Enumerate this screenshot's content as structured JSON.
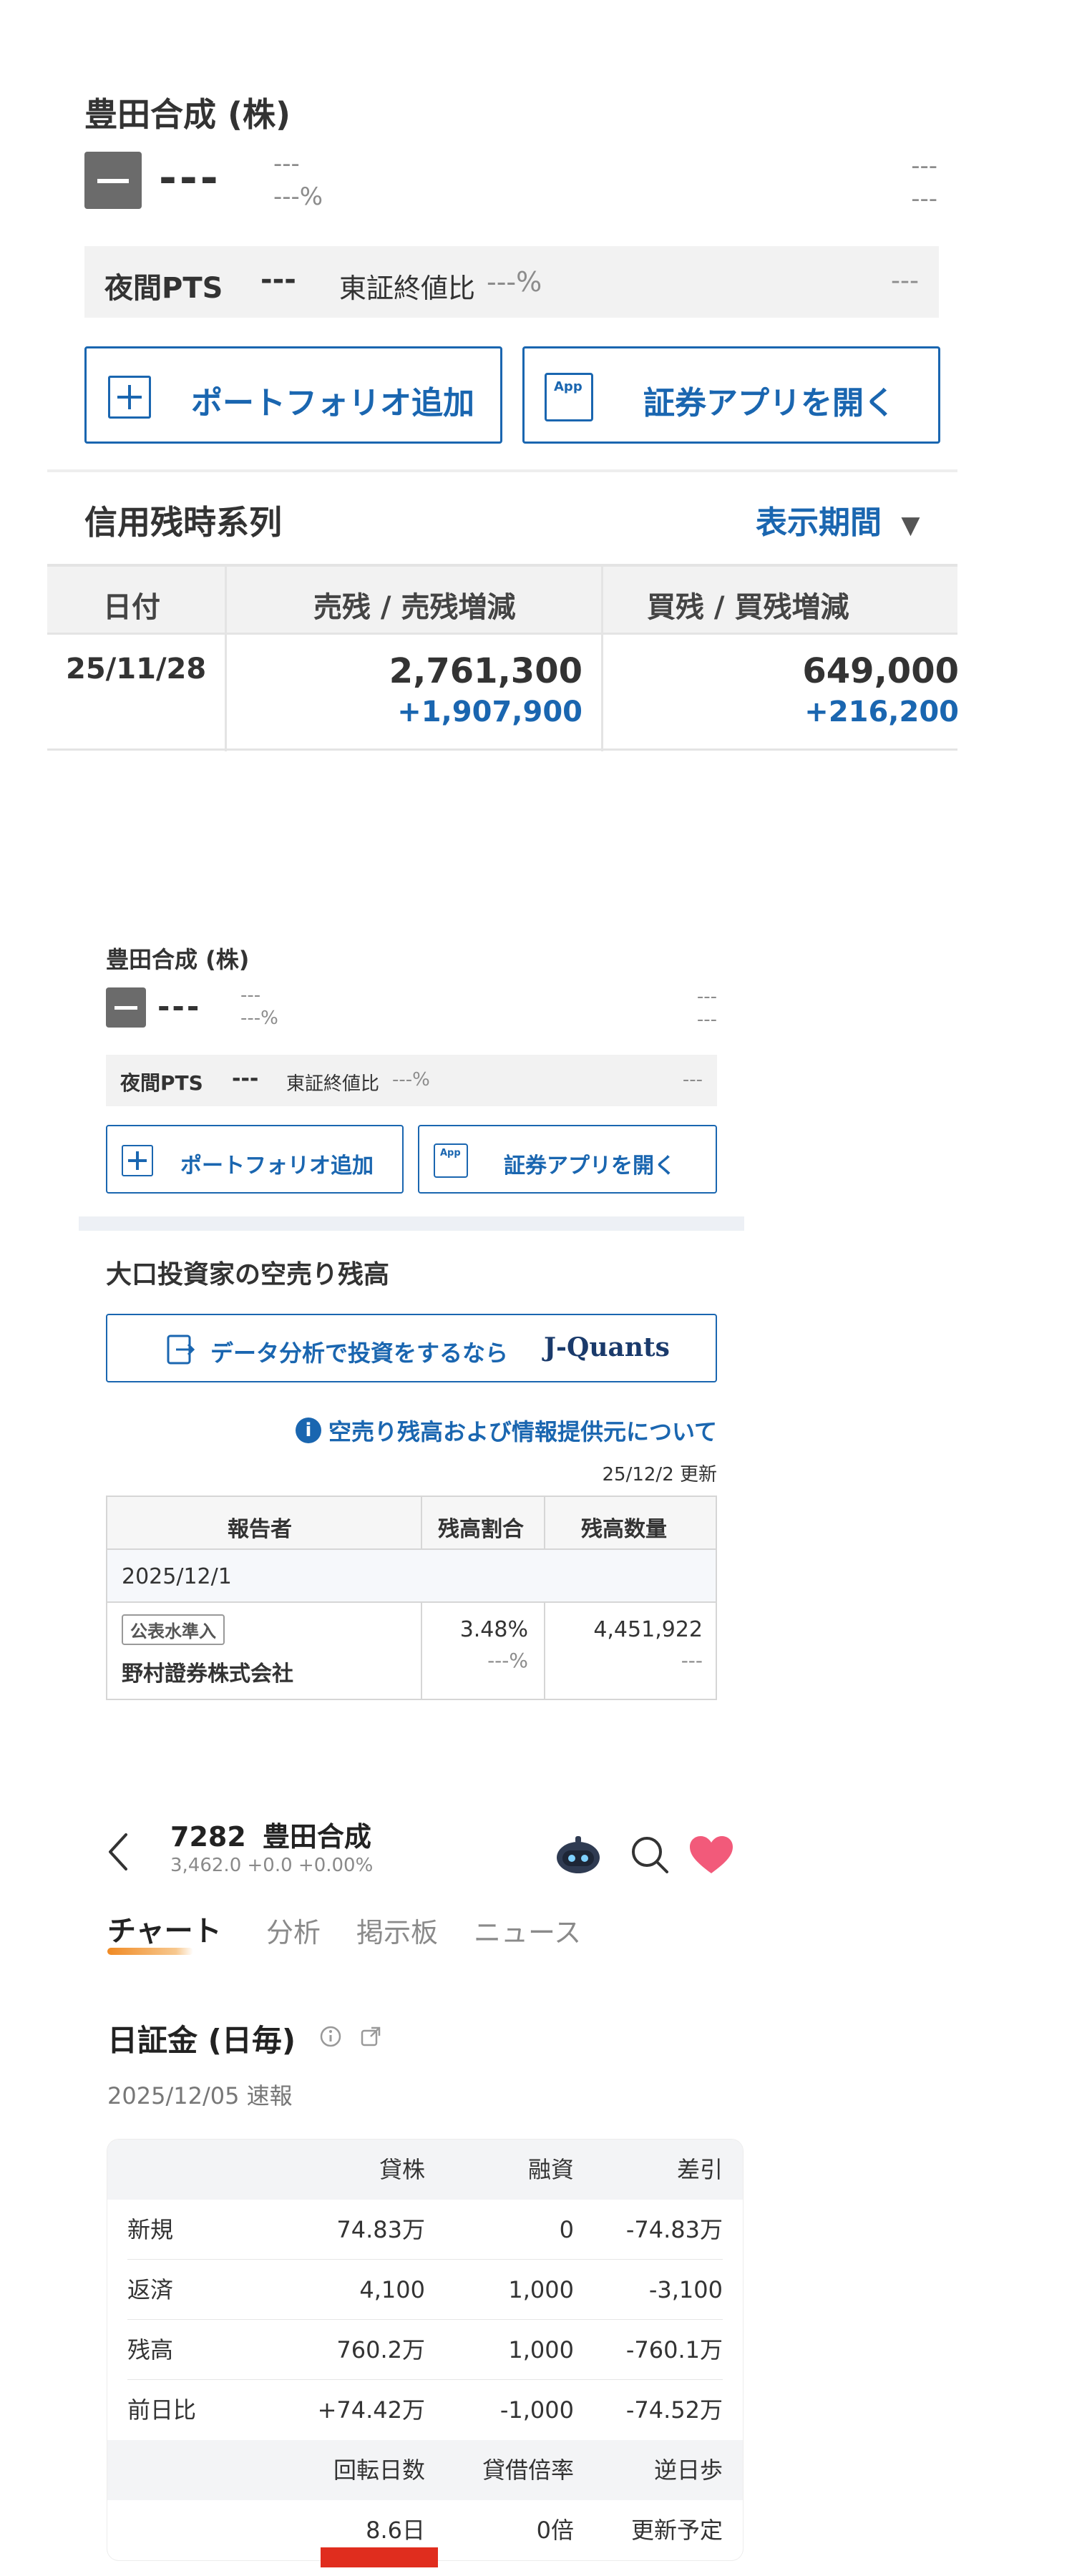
{
  "sec1": {
    "company": "豊田合成 (株)",
    "price": "---",
    "change": "---",
    "change_pct": "---%",
    "right_top": "---",
    "right_bottom": "---",
    "pts_label": "夜間PTS",
    "pts_value": "---",
    "pts_compare": "東証終値比",
    "pts_compare_value": "---%",
    "pts_right": "---",
    "btn_portfolio": "ポートフォリオ追加",
    "btn_app": "証券アプリを開く",
    "app_icon": "App",
    "section_title": "信用残時系列",
    "period_label": "表示期間",
    "table": {
      "headers": [
        "日付",
        "売残 / 売残増減",
        "買残 / 買残増減"
      ],
      "rows": [
        {
          "date": "25/11/28",
          "sell": "2,761,300",
          "sell_delta": "+1,907,900",
          "buy": "649,000",
          "buy_delta": "+216,200"
        }
      ]
    }
  },
  "sec2": {
    "company": "豊田合成 (株)",
    "price": "---",
    "change": "---",
    "change_pct": "---%",
    "right_top": "---",
    "right_bottom": "---",
    "pts_label": "夜間PTS",
    "pts_value": "---",
    "pts_compare": "東証終値比",
    "pts_compare_value": "---%",
    "pts_right": "---",
    "btn_portfolio": "ポートフォリオ追加",
    "btn_app": "証券アプリを開く",
    "app_icon": "App",
    "section_title": "大口投資家の空売り残高",
    "jquants_btn": "データ分析で投資をするなら",
    "jquants_logo": "J-Quants",
    "info_link": "空売り残高および情報提供元について",
    "updated": "25/12/2 更新",
    "table": {
      "headers": [
        "報告者",
        "残高割合",
        "残高数量"
      ],
      "date_row": "2025/12/1",
      "badge": "公表水準入",
      "reporter": "野村證券株式会社",
      "ratio": "3.48%",
      "ratio_sub": "---%",
      "qty": "4,451,922",
      "qty_sub": "---"
    }
  },
  "sec3": {
    "code": "7282",
    "name": "豊田合成",
    "quote": "3,462.0 +0.0 +0.00%",
    "tabs": [
      "チャート",
      "分析",
      "掲示板",
      "ニュース"
    ],
    "title": "日証金 (日毎)",
    "date": "2025/12/05 速報",
    "table": {
      "headers": [
        "",
        "貸株",
        "融資",
        "差引"
      ],
      "rows": [
        [
          "新規",
          "74.83万",
          "0",
          "-74.83万"
        ],
        [
          "返済",
          "4,100",
          "1,000",
          "-3,100"
        ],
        [
          "残高",
          "760.2万",
          "1,000",
          "-760.1万"
        ],
        [
          "前日比",
          "+74.42万",
          "-1,000",
          "-74.52万"
        ]
      ],
      "headers2": [
        "",
        "回転日数",
        "貸借倍率",
        "逆日歩"
      ],
      "row2": [
        "",
        "8.6日",
        "0倍",
        "更新予定"
      ]
    },
    "colors": {
      "heart": "#f25a7a",
      "tab_underline": "#f08a24",
      "red_mark": "#e02d1e"
    }
  }
}
